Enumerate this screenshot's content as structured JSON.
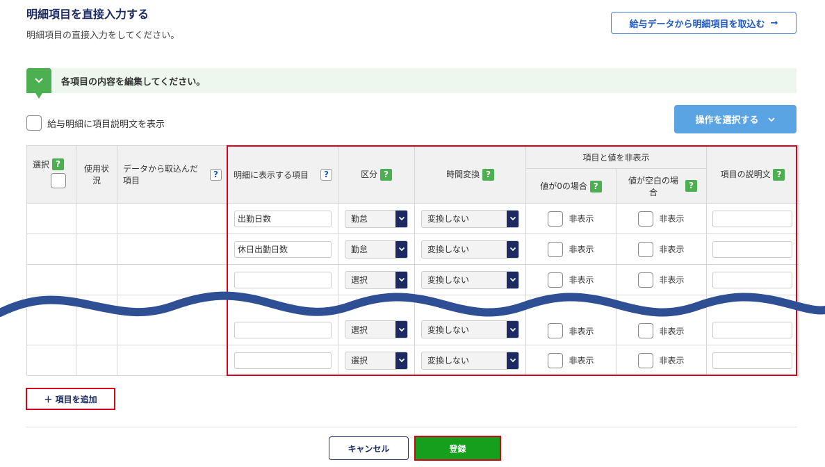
{
  "header": {
    "title": "明細項目を直接入力する",
    "subtitle": "明細項目の直接入力をしてください。",
    "import_button": "給与データから明細項目を取込む",
    "import_arrow": "→"
  },
  "info_bar": {
    "text": "各項目の内容を編集してください。",
    "icon": "chevron-down-icon"
  },
  "show_description_label": "給与明細に項目説明文を表示",
  "operations_button": "操作を選択する",
  "table": {
    "headers": {
      "select": "選択",
      "usage": "使用状況",
      "import_item": "データから取込んだ項目",
      "display_item": "明細に表示する項目",
      "category": "区分",
      "time_conversion": "時間変換",
      "hide_group": "項目と値を非表示",
      "hide_zero": "値が0の場合",
      "hide_blank": "値が空白の場合",
      "description": "項目の説明文"
    },
    "help_mark": "?",
    "rows": [
      {
        "item": "出勤日数",
        "category": "勤怠",
        "conversion": "変換しない",
        "hide_zero": "非表示",
        "hide_blank": "非表示",
        "description": ""
      },
      {
        "item": "休日出勤日数",
        "category": "勤怠",
        "conversion": "変換しない",
        "hide_zero": "非表示",
        "hide_blank": "非表示",
        "description": ""
      },
      {
        "item": "",
        "category": "選択",
        "conversion": "変換しない",
        "hide_zero": "非表示",
        "hide_blank": "非表示",
        "description": ""
      },
      {
        "item": "",
        "category": "選択",
        "conversion": "変換しない",
        "hide_zero": "非表示",
        "hide_blank": "非表示",
        "description": ""
      },
      {
        "item": "",
        "category": "選択",
        "conversion": "変換しない",
        "hide_zero": "非表示",
        "hide_blank": "非表示",
        "description": ""
      }
    ]
  },
  "add_item_button": "＋ 項目を追加",
  "cancel_button": "キャンセル",
  "submit_button": "登録",
  "colors": {
    "title": "#1b2a63",
    "accent_green": "#4caf50",
    "highlight_red": "#d9001b",
    "wave_blue": "#2e4f93"
  }
}
